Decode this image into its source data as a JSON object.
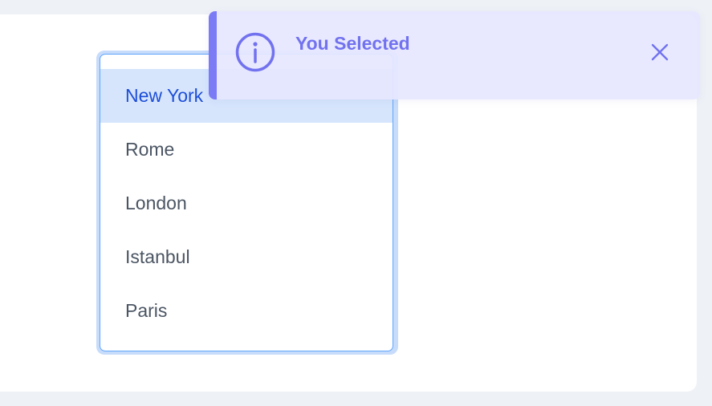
{
  "listbox": {
    "selected_index": 0,
    "options": [
      {
        "label": "New York"
      },
      {
        "label": "Rome"
      },
      {
        "label": "London"
      },
      {
        "label": "Istanbul"
      },
      {
        "label": "Paris"
      }
    ]
  },
  "toast": {
    "severity": "info",
    "title": "You Selected",
    "detail": "",
    "icon": "info-circle-icon",
    "close_icon": "close-icon",
    "accent_color": "#7b7bf6",
    "text_color": "#7272ef"
  },
  "colors": {
    "focus_border": "#60a5fa",
    "selected_bg": "#d6e5fc",
    "selected_text": "#1d4ed8"
  }
}
